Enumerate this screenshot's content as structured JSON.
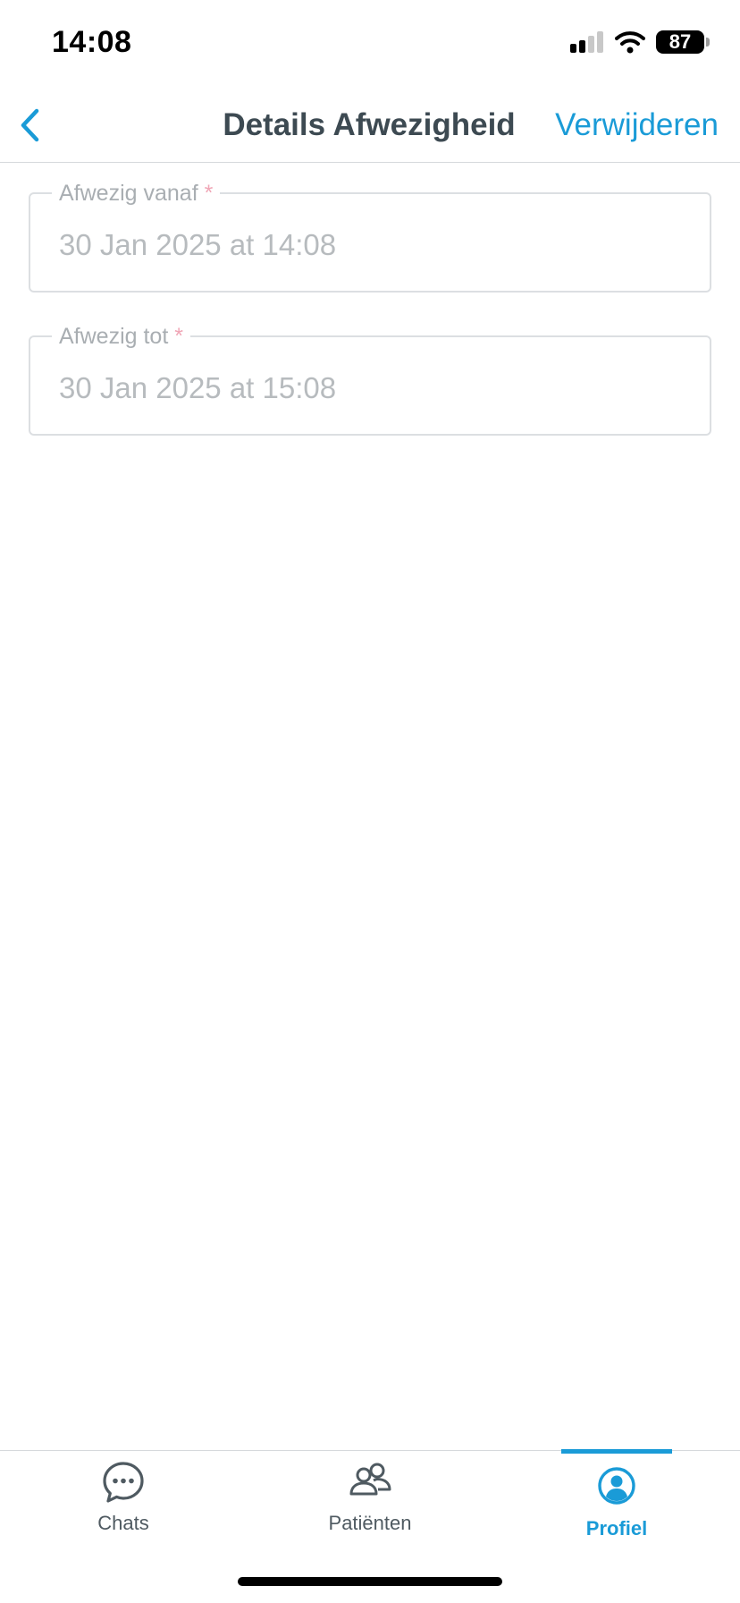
{
  "status_bar": {
    "time": "14:08",
    "battery": "87",
    "icons": [
      "signal-icon",
      "wifi-icon",
      "battery-icon"
    ]
  },
  "nav": {
    "title": "Details Afwezigheid",
    "delete_label": "Verwijderen",
    "back_icon": "chevron-left-icon"
  },
  "fields": [
    {
      "label": "Afwezig vanaf",
      "required_mark": "*",
      "value": "30 Jan 2025 at 14:08"
    },
    {
      "label": "Afwezig tot",
      "required_mark": "*",
      "value": "30 Jan 2025 at 15:08"
    }
  ],
  "tabs": [
    {
      "label": "Chats",
      "icon": "chat-bubble-icon",
      "active": false
    },
    {
      "label": "Patiënten",
      "icon": "users-icon",
      "active": false
    },
    {
      "label": "Profiel",
      "icon": "user-circle-icon",
      "active": true
    }
  ],
  "colors": {
    "accent": "#1a9bd7",
    "title": "#3d4a52",
    "required": "#f0a6b6",
    "placeholder": "#b7bbbe"
  }
}
